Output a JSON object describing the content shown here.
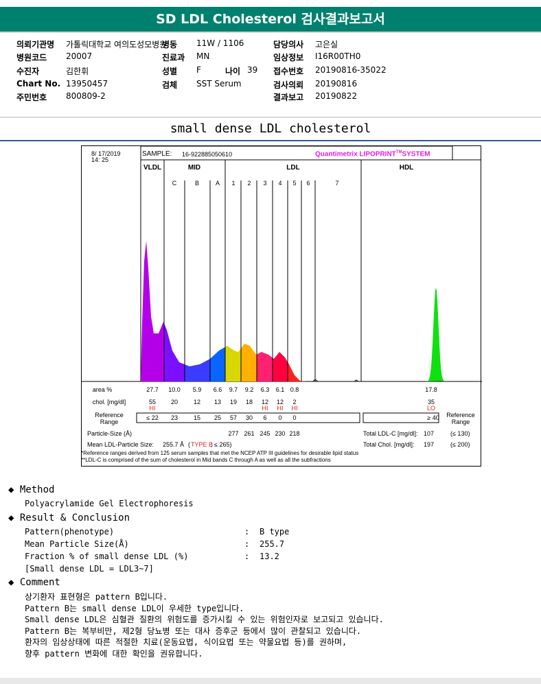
{
  "title": "SD LDL Cholesterol 검사결과보고서",
  "info": [
    {
      "label": "의뢰기관명",
      "value": "가톨릭대학교 여의도성모병원",
      "col": 0,
      "row": 0
    },
    {
      "label": "병동",
      "value": "11W / 1106",
      "col": 1,
      "row": 0
    },
    {
      "label": "담당의사",
      "value": "고은실",
      "col": 2,
      "row": 0
    },
    {
      "label": "병원코드",
      "value": "20007",
      "col": 0,
      "row": 1
    },
    {
      "label": "진료과",
      "value": "MN",
      "col": 1,
      "row": 1
    },
    {
      "label": "임상정보",
      "value": "I16R00TH0",
      "col": 2,
      "row": 1
    },
    {
      "label": "수진자",
      "value": "김한휘",
      "col": 0,
      "row": 2
    },
    {
      "label": "성별",
      "value": "F",
      "col": 1,
      "row": 2
    },
    {
      "label": "접수번호",
      "value": "20190816-35022",
      "col": 2,
      "row": 2
    },
    {
      "label": "Chart No.",
      "value": "13950457",
      "col": 0,
      "row": 3
    },
    {
      "label": "검체",
      "value": "SST Serum",
      "col": 1,
      "row": 3
    },
    {
      "label": "검사의뢰",
      "value": "20190816",
      "col": 2,
      "row": 3
    },
    {
      "label": "주민번호",
      "value": "800809-2",
      "col": 0,
      "row": 4
    },
    {
      "label": "결과보고",
      "value": "20190822",
      "col": 2,
      "row": 4
    }
  ],
  "age": {
    "label": "나이",
    "value": "39"
  },
  "subtitle": "small dense LDL cholesterol",
  "chart": {
    "date": "8/ 17/2019",
    "time": "14: 25",
    "sample_label": "SAMPLE:",
    "sample": "16-922885050610",
    "brand": "Quantimetrix LIPOPRINT",
    "brand_tm": "TM",
    "brand_suffix": "SYSTEM",
    "groups": [
      "VLDL",
      "MID",
      "LDL",
      "HDL"
    ],
    "bands": [
      "C",
      "B",
      "A",
      "1",
      "2",
      "3",
      "4",
      "5",
      "6",
      "7"
    ],
    "row_labels": {
      "area": "area %",
      "chol": "chol. [mg/dl]",
      "ref": "Reference Range",
      "size": "Particle-Size (Å)",
      "mean": "Mean LDL-Particle Size:"
    },
    "fractions": [
      {
        "name": "VLDL",
        "area": "27.7",
        "chol": "55",
        "flag": "HI",
        "ref": "≤ 22",
        "size": "",
        "color": "#b400e8"
      },
      {
        "name": "C",
        "area": "10.0",
        "chol": "20",
        "flag": "",
        "ref": "23",
        "size": "",
        "color": "#7a10ff"
      },
      {
        "name": "B",
        "area": "5.9",
        "chol": "12",
        "flag": "",
        "ref": "15",
        "size": "",
        "color": "#3a3cff"
      },
      {
        "name": "A",
        "area": "6.6",
        "chol": "13",
        "flag": "",
        "ref": "25",
        "size": "",
        "color": "#0a64ff"
      },
      {
        "name": "1",
        "area": "9.7",
        "chol": "19",
        "flag": "",
        "ref": "57",
        "size": "277",
        "color": "#d8d800"
      },
      {
        "name": "2",
        "area": "9.2",
        "chol": "18",
        "flag": "",
        "ref": "30",
        "size": "261",
        "color": "#ffb000"
      },
      {
        "name": "3",
        "area": "6.3",
        "chol": "12",
        "flag": "HI",
        "ref": "6",
        "size": "245",
        "color": "#ff2070"
      },
      {
        "name": "4",
        "area": "6.1",
        "chol": "12",
        "flag": "HI",
        "ref": "0",
        "size": "230",
        "color": "#ff0040"
      },
      {
        "name": "5",
        "area": "0.8",
        "chol": "2",
        "flag": "HI",
        "ref": "0",
        "size": "218",
        "color": "#ff2020"
      },
      {
        "name": "HDL",
        "area": "17.8",
        "chol": "35",
        "flag": "LO",
        "ref": "≥ 40",
        "size": "",
        "color": "#10e010"
      }
    ],
    "mean_size": "255.7 Å",
    "type": "TYPE B",
    "type_ref": "; ≤ 265)",
    "type_open": "(",
    "total_ldl_label": "Total LDL-C [mg/dl]:",
    "total_ldl": "107",
    "total_ldl_ref": "(≤ 130)",
    "total_chol_label": "Total Chol. [mg/dl]:",
    "total_chol": "197",
    "total_chol_ref": "(≤ 200)",
    "ref_right": "Reference Range"
  },
  "footnotes": [
    "*Reference ranges derived from 125 serum samples that met the NCEP ATP III guidelines for desirable lipid status",
    "**LDL-C is comprised of the sum of cholesterol in Mid bands C through A as well as all the subfractions"
  ],
  "method": {
    "heading": "Method",
    "text": "Polyacrylamide Gel Electrophoresis"
  },
  "result": {
    "heading": "Result & Conclusion",
    "rows": [
      {
        "k": "Pattern(phenotype)",
        "v": "B type"
      },
      {
        "k": "Mean Particle Size(Å)",
        "v": "255.7"
      },
      {
        "k": "Fraction % of small dense LDL (%)",
        "v": "13.2"
      }
    ],
    "note": "[Small dense LDL = LDL3~7]"
  },
  "comment": {
    "heading": "Comment",
    "lines": [
      "상기환자 표현형은 pattern B입니다.",
      "Pattern B는 small dense LDL이 우세한 type입니다.",
      "Small dense LDL은 심혈관 질환의 위험도를 증가시킬 수 있는 위험인자로 보고되고 있습니다.",
      "Pattern B는 복부비만, 제2형 당뇨병 또는 대사 증후군 등에서 많이 관찰되고 있습니다.",
      "환자의 임상상태에 따른 적절한 치료(운동요법, 식이요법 또는 약물요법 등)를 권하며,",
      "향후 pattern 변화에 대한 확인을 권유합니다."
    ]
  }
}
